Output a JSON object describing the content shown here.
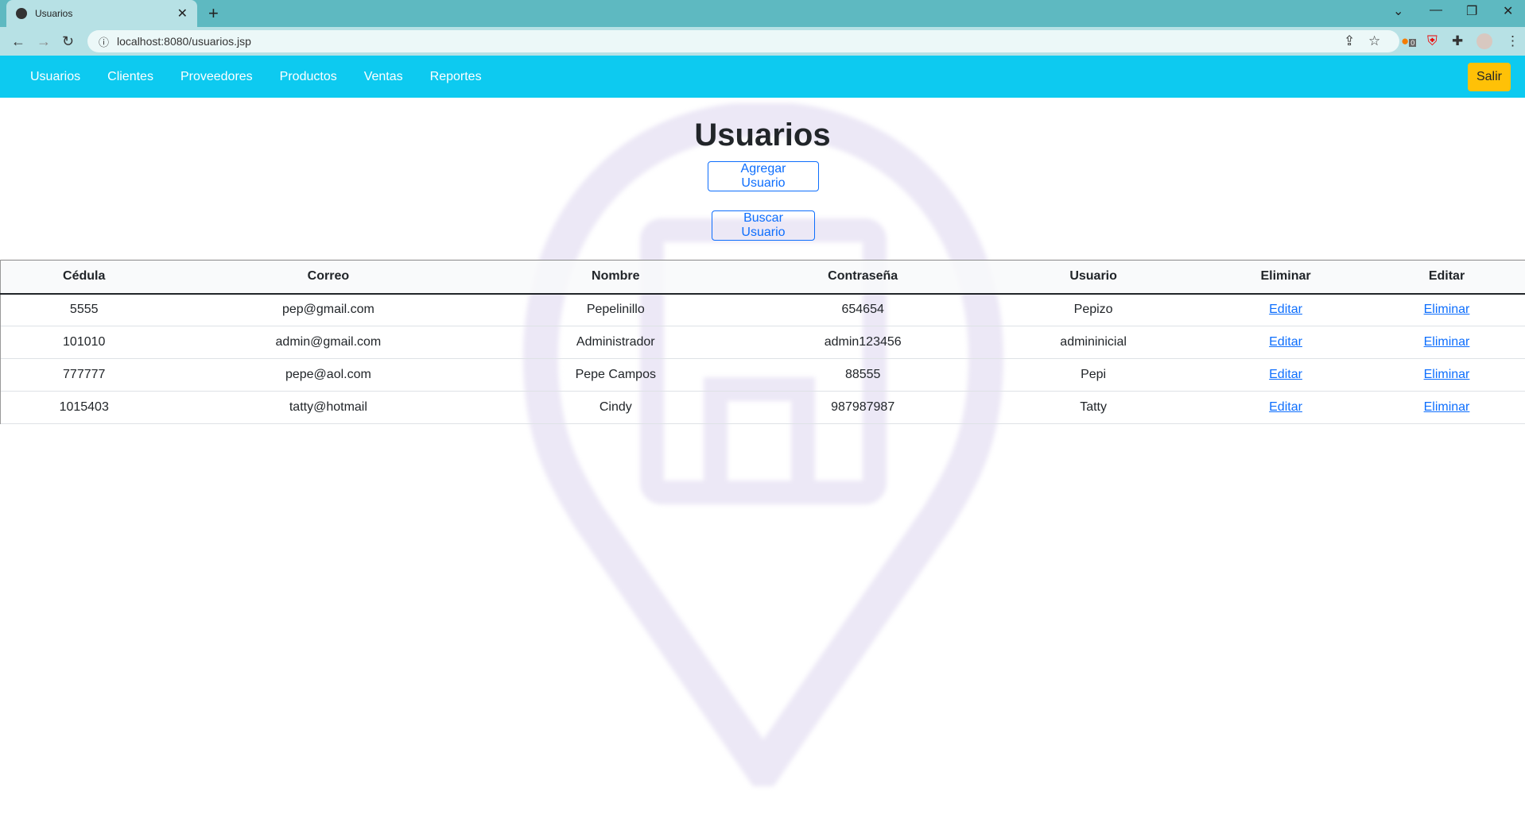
{
  "browser": {
    "tab_title": "Usuarios",
    "url": "localhost:8080/usuarios.jsp",
    "extension_badge": "0"
  },
  "navbar": {
    "links": [
      "Usuarios",
      "Clientes",
      "Proveedores",
      "Productos",
      "Ventas",
      "Reportes"
    ],
    "logout_label": "Salir"
  },
  "page": {
    "title": "Usuarios",
    "add_button": "Agregar Usuario",
    "search_button": "Buscar Usuario"
  },
  "table": {
    "headers": [
      "Cédula",
      "Correo",
      "Nombre",
      "Contraseña",
      "Usuario",
      "Eliminar",
      "Editar"
    ],
    "rows": [
      {
        "cedula": "5555",
        "correo": "pep@gmail.com",
        "nombre": "Pepelinillo",
        "contrasena": "654654",
        "usuario": "Pepizo",
        "edit": "Editar",
        "delete": "Eliminar"
      },
      {
        "cedula": "101010",
        "correo": "admin@gmail.com",
        "nombre": "Administrador",
        "contrasena": "admin123456",
        "usuario": "admininicial",
        "edit": "Editar",
        "delete": "Eliminar"
      },
      {
        "cedula": "777777",
        "correo": "pepe@aol.com",
        "nombre": "Pepe Campos",
        "contrasena": "88555",
        "usuario": "Pepi",
        "edit": "Editar",
        "delete": "Eliminar"
      },
      {
        "cedula": "1015403",
        "correo": "tatty@hotmail",
        "nombre": "Cindy",
        "contrasena": "987987987",
        "usuario": "Tatty",
        "edit": "Editar",
        "delete": "Eliminar"
      }
    ]
  },
  "colors": {
    "navbar": "#0dcaf0",
    "logout": "#ffc107",
    "primary": "#0d6efd",
    "watermark": "#ece8f6"
  }
}
